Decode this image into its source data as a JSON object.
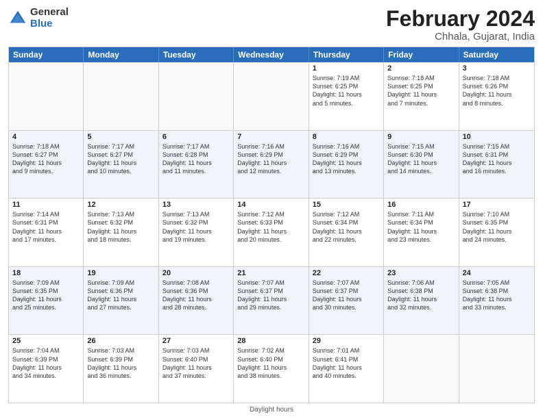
{
  "logo": {
    "general": "General",
    "blue": "Blue"
  },
  "title": {
    "month_year": "February 2024",
    "location": "Chhala, Gujarat, India"
  },
  "days_of_week": [
    "Sunday",
    "Monday",
    "Tuesday",
    "Wednesday",
    "Thursday",
    "Friday",
    "Saturday"
  ],
  "weeks": [
    [
      {
        "day": "",
        "info": ""
      },
      {
        "day": "",
        "info": ""
      },
      {
        "day": "",
        "info": ""
      },
      {
        "day": "",
        "info": ""
      },
      {
        "day": "1",
        "info": "Sunrise: 7:19 AM\nSunset: 6:25 PM\nDaylight: 11 hours\nand 5 minutes."
      },
      {
        "day": "2",
        "info": "Sunrise: 7:18 AM\nSunset: 6:25 PM\nDaylight: 11 hours\nand 7 minutes."
      },
      {
        "day": "3",
        "info": "Sunrise: 7:18 AM\nSunset: 6:26 PM\nDaylight: 11 hours\nand 8 minutes."
      }
    ],
    [
      {
        "day": "4",
        "info": "Sunrise: 7:18 AM\nSunset: 6:27 PM\nDaylight: 11 hours\nand 9 minutes."
      },
      {
        "day": "5",
        "info": "Sunrise: 7:17 AM\nSunset: 6:27 PM\nDaylight: 11 hours\nand 10 minutes."
      },
      {
        "day": "6",
        "info": "Sunrise: 7:17 AM\nSunset: 6:28 PM\nDaylight: 11 hours\nand 11 minutes."
      },
      {
        "day": "7",
        "info": "Sunrise: 7:16 AM\nSunset: 6:29 PM\nDaylight: 11 hours\nand 12 minutes."
      },
      {
        "day": "8",
        "info": "Sunrise: 7:16 AM\nSunset: 6:29 PM\nDaylight: 11 hours\nand 13 minutes."
      },
      {
        "day": "9",
        "info": "Sunrise: 7:15 AM\nSunset: 6:30 PM\nDaylight: 11 hours\nand 14 minutes."
      },
      {
        "day": "10",
        "info": "Sunrise: 7:15 AM\nSunset: 6:31 PM\nDaylight: 11 hours\nand 16 minutes."
      }
    ],
    [
      {
        "day": "11",
        "info": "Sunrise: 7:14 AM\nSunset: 6:31 PM\nDaylight: 11 hours\nand 17 minutes."
      },
      {
        "day": "12",
        "info": "Sunrise: 7:13 AM\nSunset: 6:32 PM\nDaylight: 11 hours\nand 18 minutes."
      },
      {
        "day": "13",
        "info": "Sunrise: 7:13 AM\nSunset: 6:32 PM\nDaylight: 11 hours\nand 19 minutes."
      },
      {
        "day": "14",
        "info": "Sunrise: 7:12 AM\nSunset: 6:33 PM\nDaylight: 11 hours\nand 20 minutes."
      },
      {
        "day": "15",
        "info": "Sunrise: 7:12 AM\nSunset: 6:34 PM\nDaylight: 11 hours\nand 22 minutes."
      },
      {
        "day": "16",
        "info": "Sunrise: 7:11 AM\nSunset: 6:34 PM\nDaylight: 11 hours\nand 23 minutes."
      },
      {
        "day": "17",
        "info": "Sunrise: 7:10 AM\nSunset: 6:35 PM\nDaylight: 11 hours\nand 24 minutes."
      }
    ],
    [
      {
        "day": "18",
        "info": "Sunrise: 7:09 AM\nSunset: 6:35 PM\nDaylight: 11 hours\nand 25 minutes."
      },
      {
        "day": "19",
        "info": "Sunrise: 7:09 AM\nSunset: 6:36 PM\nDaylight: 11 hours\nand 27 minutes."
      },
      {
        "day": "20",
        "info": "Sunrise: 7:08 AM\nSunset: 6:36 PM\nDaylight: 11 hours\nand 28 minutes."
      },
      {
        "day": "21",
        "info": "Sunrise: 7:07 AM\nSunset: 6:37 PM\nDaylight: 11 hours\nand 29 minutes."
      },
      {
        "day": "22",
        "info": "Sunrise: 7:07 AM\nSunset: 6:37 PM\nDaylight: 11 hours\nand 30 minutes."
      },
      {
        "day": "23",
        "info": "Sunrise: 7:06 AM\nSunset: 6:38 PM\nDaylight: 11 hours\nand 32 minutes."
      },
      {
        "day": "24",
        "info": "Sunrise: 7:05 AM\nSunset: 6:38 PM\nDaylight: 11 hours\nand 33 minutes."
      }
    ],
    [
      {
        "day": "25",
        "info": "Sunrise: 7:04 AM\nSunset: 6:39 PM\nDaylight: 11 hours\nand 34 minutes."
      },
      {
        "day": "26",
        "info": "Sunrise: 7:03 AM\nSunset: 6:39 PM\nDaylight: 11 hours\nand 36 minutes."
      },
      {
        "day": "27",
        "info": "Sunrise: 7:03 AM\nSunset: 6:40 PM\nDaylight: 11 hours\nand 37 minutes."
      },
      {
        "day": "28",
        "info": "Sunrise: 7:02 AM\nSunset: 6:40 PM\nDaylight: 11 hours\nand 38 minutes."
      },
      {
        "day": "29",
        "info": "Sunrise: 7:01 AM\nSunset: 6:41 PM\nDaylight: 11 hours\nand 40 minutes."
      },
      {
        "day": "",
        "info": ""
      },
      {
        "day": "",
        "info": ""
      }
    ]
  ],
  "footer": {
    "note": "Daylight hours"
  }
}
